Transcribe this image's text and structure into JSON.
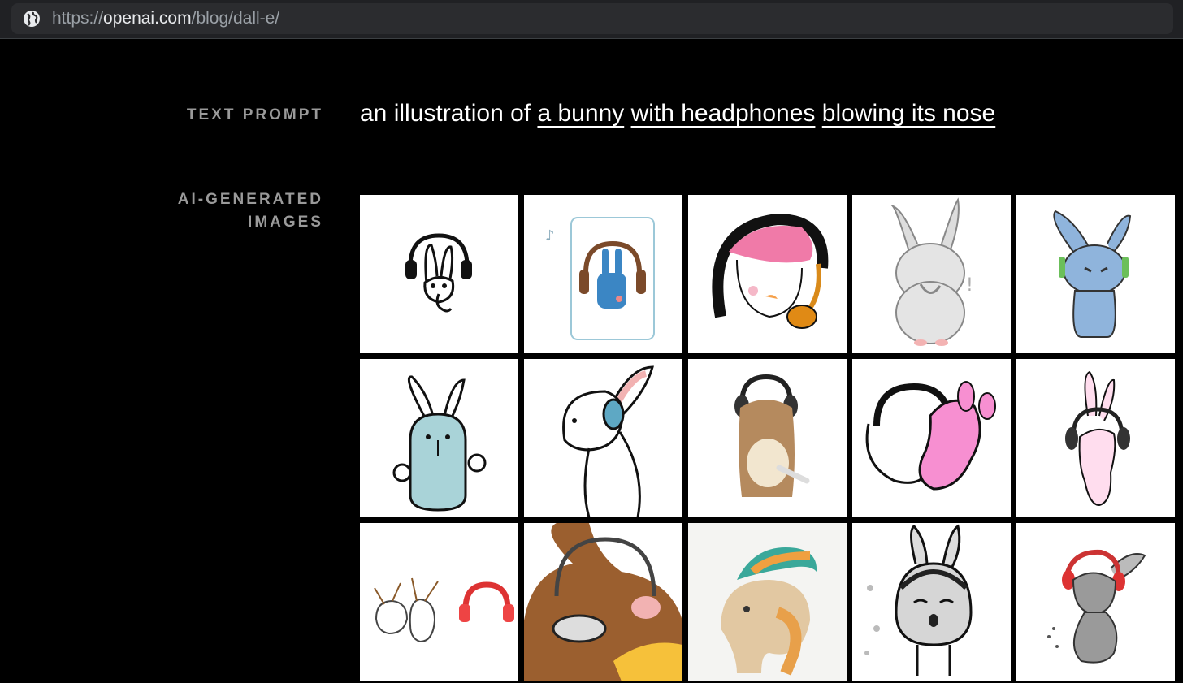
{
  "browser": {
    "url_scheme": "https://",
    "url_domain": "openai.com",
    "url_path": "/blog/dall-e/",
    "site_icon": "globe-icon"
  },
  "labels": {
    "text_prompt": "TEXT PROMPT",
    "ai_generated_line1": "AI-GENERATED",
    "ai_generated_line2": "IMAGES"
  },
  "prompt": {
    "prefix": "an illustration of ",
    "segments": [
      "a bunny",
      "with headphones",
      "blowing its nose"
    ]
  },
  "images": [
    {
      "subject": "bunny-headphones-outline"
    },
    {
      "subject": "blue-bunny-card"
    },
    {
      "subject": "pink-headphones-closeup"
    },
    {
      "subject": "grey-bunny-tissue"
    },
    {
      "subject": "blue-bunny-sitting"
    },
    {
      "subject": "teal-bunny-outline"
    },
    {
      "subject": "bunny-profile-headphones"
    },
    {
      "subject": "brown-bunny-headphones"
    },
    {
      "subject": "pink-heart-bunny"
    },
    {
      "subject": "pink-bunny-headphones"
    },
    {
      "subject": "bunnies-red-headphones"
    },
    {
      "subject": "brown-bunny-closeup"
    },
    {
      "subject": "orange-bird-creature"
    },
    {
      "subject": "grey-bunny-sneezing"
    },
    {
      "subject": "grey-bunny-red-headphones"
    }
  ]
}
